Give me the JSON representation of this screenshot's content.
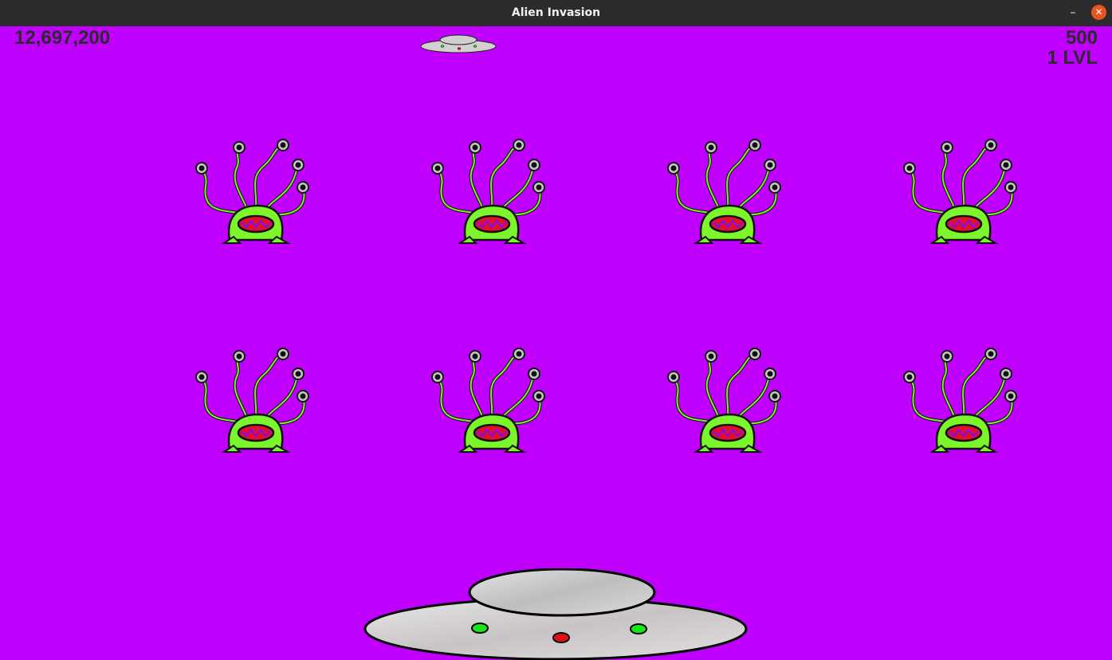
{
  "window": {
    "title": "Alien Invasion",
    "minimize_icon": "minimize-icon",
    "close_icon": "close-icon"
  },
  "hud": {
    "score": "12,697,200",
    "high_score": "500",
    "level": "1 LVL"
  },
  "colors": {
    "background": "#bf00ff",
    "alien_body": "#7cf52c",
    "alien_mouth": "#e0102a",
    "ship_hull": "#d4d0d0",
    "ship_light_green": "#19e619",
    "ship_light_red": "#e11111"
  },
  "fleet": {
    "rows": 2,
    "columns": 4,
    "alien_icon": "tentacled-alien-icon"
  },
  "lives": {
    "count": 1,
    "icon": "flying-saucer-icon"
  },
  "player_ship_icon": "flying-saucer-icon"
}
